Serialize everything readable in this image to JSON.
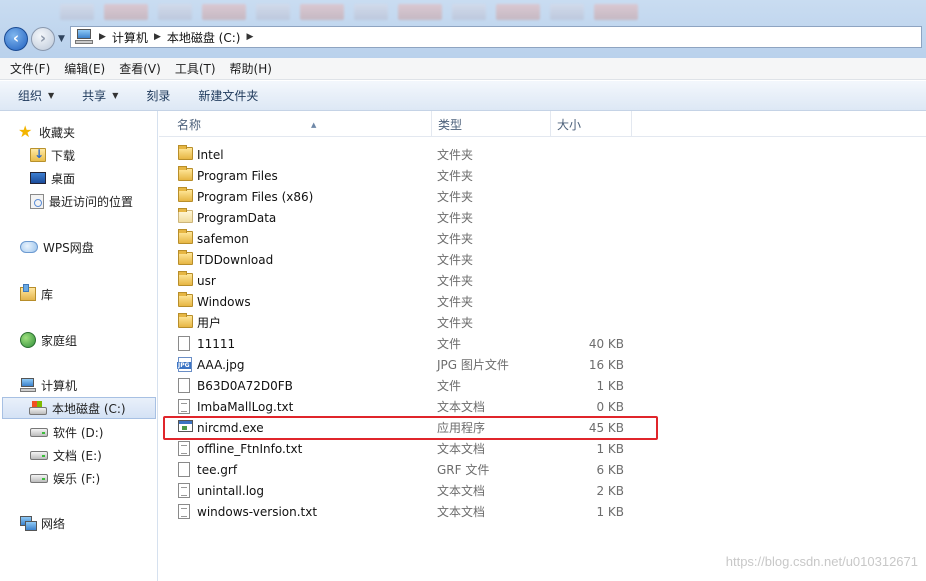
{
  "breadcrumb": {
    "items": [
      "计算机",
      "本地磁盘 (C:)"
    ]
  },
  "menu": [
    "文件(F)",
    "编辑(E)",
    "查看(V)",
    "工具(T)",
    "帮助(H)"
  ],
  "commands": {
    "organize": "组织",
    "share": "共享",
    "burn": "刻录",
    "new_folder": "新建文件夹"
  },
  "nav": {
    "favorites": "收藏夹",
    "downloads": "下载",
    "desktop": "桌面",
    "recent": "最近访问的位置",
    "wps": "WPS网盘",
    "library": "库",
    "homegroup": "家庭组",
    "computer": "计算机",
    "drive_c": "本地磁盘 (C:)",
    "drive_d": "软件 (D:)",
    "drive_e": "文档 (E:)",
    "drive_f": "娱乐 (F:)",
    "network": "网络"
  },
  "columns": {
    "name": "名称",
    "type": "类型",
    "size": "大小"
  },
  "files": [
    {
      "name": "Intel",
      "type": "文件夹",
      "size": ""
    },
    {
      "name": "Program Files",
      "type": "文件夹",
      "size": ""
    },
    {
      "name": "Program Files (x86)",
      "type": "文件夹",
      "size": ""
    },
    {
      "name": "ProgramData",
      "type": "文件夹",
      "size": ""
    },
    {
      "name": "safemon",
      "type": "文件夹",
      "size": ""
    },
    {
      "name": "TDDownload",
      "type": "文件夹",
      "size": ""
    },
    {
      "name": "usr",
      "type": "文件夹",
      "size": ""
    },
    {
      "name": "Windows",
      "type": "文件夹",
      "size": ""
    },
    {
      "name": "用户",
      "type": "文件夹",
      "size": ""
    },
    {
      "name": "11111",
      "type": "文件",
      "size": "40 KB"
    },
    {
      "name": "AAA.jpg",
      "type": "JPG 图片文件",
      "size": "16 KB"
    },
    {
      "name": "B63D0A72D0FB",
      "type": "文件",
      "size": "1 KB"
    },
    {
      "name": "ImbaMallLog.txt",
      "type": "文本文档",
      "size": "0 KB"
    },
    {
      "name": "nircmd.exe",
      "type": "应用程序",
      "size": "45 KB"
    },
    {
      "name": "offline_FtnInfo.txt",
      "type": "文本文档",
      "size": "1 KB"
    },
    {
      "name": "tee.grf",
      "type": "GRF 文件",
      "size": "6 KB"
    },
    {
      "name": "unintall.log",
      "type": "文本文档",
      "size": "2 KB"
    },
    {
      "name": "windows-version.txt",
      "type": "文本文档",
      "size": "1 KB"
    }
  ],
  "watermark": "https://blog.csdn.net/u010312671"
}
